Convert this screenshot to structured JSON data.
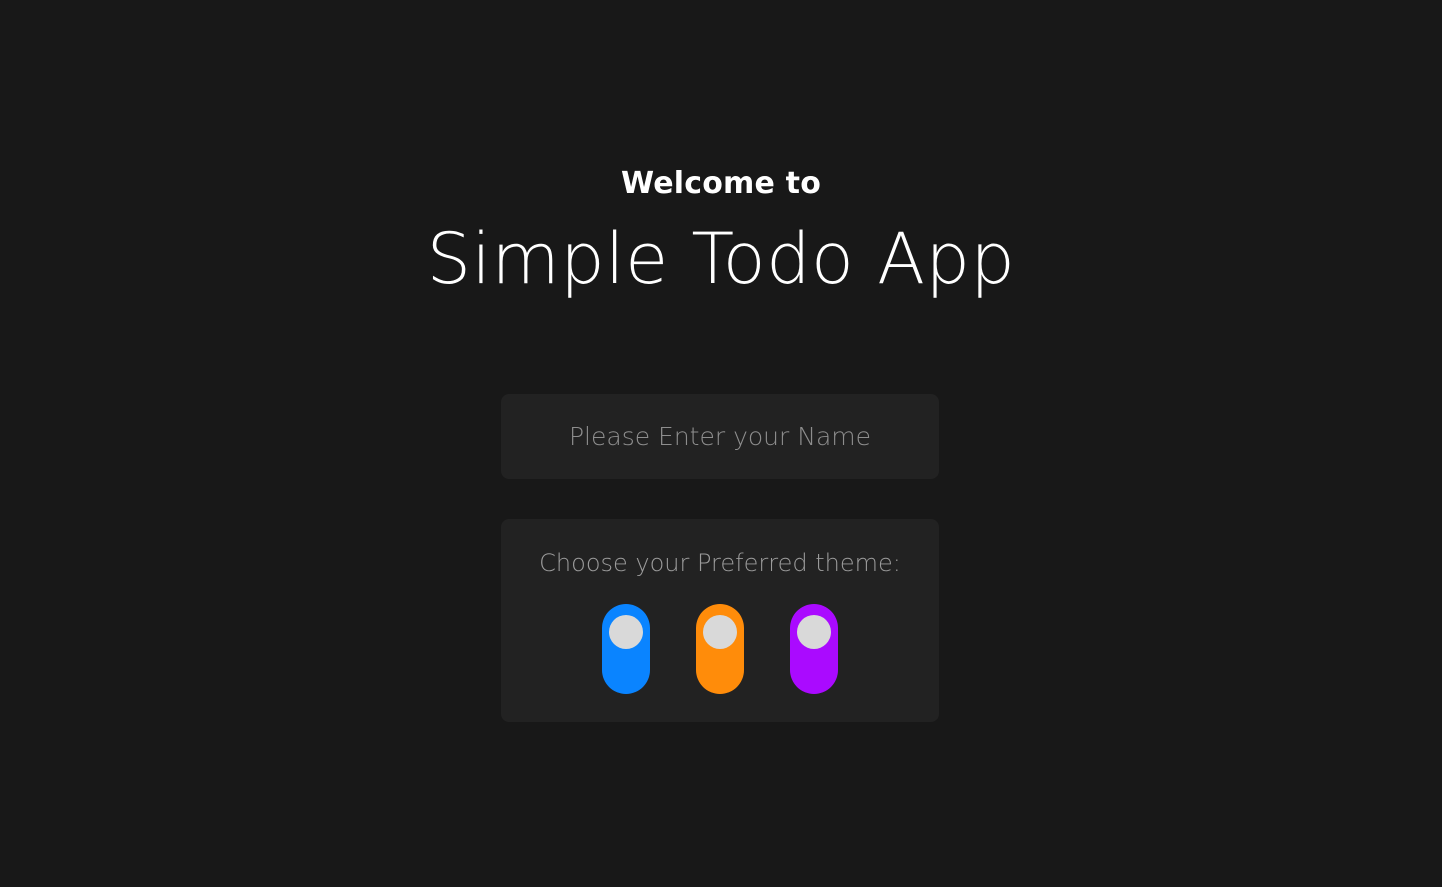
{
  "header": {
    "welcome": "Welcome to",
    "title": "Simple Todo App"
  },
  "name_input": {
    "placeholder": "Please Enter your Name",
    "value": ""
  },
  "theme_picker": {
    "label": "Choose your Preferred theme:",
    "options": [
      {
        "name": "blue",
        "color": "#0a84ff",
        "selected": false
      },
      {
        "name": "orange",
        "color": "#ff8c0a",
        "selected": false
      },
      {
        "name": "purple",
        "color": "#aa0aff",
        "selected": false
      }
    ]
  },
  "colors": {
    "background": "#181818",
    "panel": "#222222",
    "knob": "#d9d9d9"
  }
}
